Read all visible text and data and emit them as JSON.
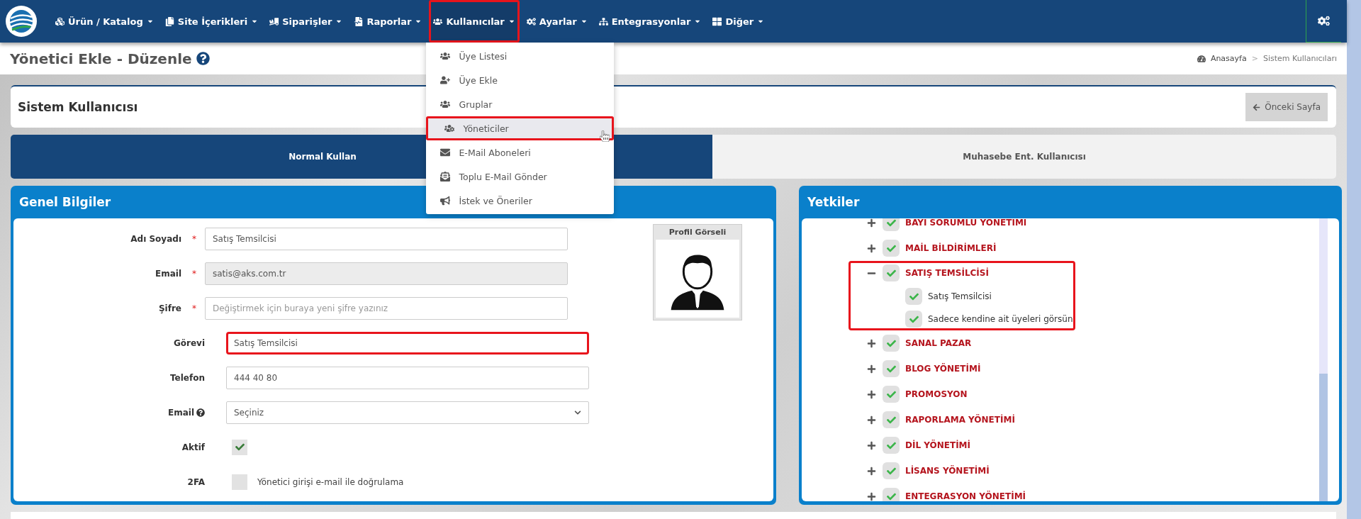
{
  "nav": {
    "items": [
      {
        "label": "Ürün / Katalog",
        "highlighted": false,
        "open": false
      },
      {
        "label": "Site İçerikleri",
        "highlighted": false,
        "open": false
      },
      {
        "label": "Siparişler",
        "highlighted": false,
        "open": false
      },
      {
        "label": "Raporlar",
        "highlighted": false,
        "open": false
      },
      {
        "label": "Kullanıcılar",
        "highlighted": true,
        "open": true
      },
      {
        "label": "Ayarlar",
        "highlighted": false,
        "open": false
      },
      {
        "label": "Entegrasyonlar",
        "highlighted": false,
        "open": false
      },
      {
        "label": "Diğer",
        "highlighted": false,
        "open": false
      }
    ]
  },
  "dropdown": {
    "items": [
      {
        "label": "Üye Listesi",
        "hovered": false,
        "highlighted": false
      },
      {
        "label": "Üye Ekle",
        "hovered": false,
        "highlighted": false
      },
      {
        "label": "Gruplar",
        "hovered": false,
        "highlighted": false
      },
      {
        "label": "Yöneticiler",
        "hovered": true,
        "highlighted": true
      },
      {
        "label": "E-Mail Aboneleri",
        "hovered": false,
        "highlighted": false
      },
      {
        "label": "Toplu E-Mail Gönder",
        "hovered": false,
        "highlighted": false
      },
      {
        "label": "İstek ve Öneriler",
        "hovered": false,
        "highlighted": false
      }
    ]
  },
  "page_title": "Yönetici Ekle - Düzenle",
  "breadcrumb": {
    "separator": ">",
    "items": [
      "Anasayfa",
      "Sistem Kullanıcıları"
    ]
  },
  "card": {
    "title": "Sistem Kullanıcısı",
    "back_button": "Önceki Sayfa"
  },
  "tabs": [
    {
      "label": "Normal Kullan",
      "selected": true
    },
    {
      "label": "Muhasebe Ent. Kullanıcısı",
      "selected": false
    }
  ],
  "general": {
    "title": "Genel Bilgiler",
    "profile_label": "Profil Görseli",
    "fields": [
      {
        "kind": "text",
        "label": "Adı Soyadı",
        "required_mark": "*",
        "help": false,
        "disabled": false,
        "highlighted": false,
        "value": "Satış Temsilcisi"
      },
      {
        "kind": "text",
        "label": "Email",
        "required_mark": "*",
        "help": false,
        "disabled": true,
        "highlighted": false,
        "value": "satis@aks.com.tr"
      },
      {
        "kind": "text",
        "label": "Şifre",
        "required_mark": "*",
        "help": false,
        "disabled": false,
        "highlighted": false,
        "placeholder": "Değiştirmek için buraya yeni şifre yazınız"
      },
      {
        "kind": "text",
        "label": "Görevi",
        "help": false,
        "disabled": false,
        "highlighted": true,
        "value": "Satış Temsilcisi"
      },
      {
        "kind": "text",
        "label": "Telefon",
        "help": false,
        "disabled": false,
        "highlighted": false,
        "value": "444 40 80"
      },
      {
        "kind": "select",
        "label": "Email",
        "help": true,
        "value": "Seçiniz"
      },
      {
        "kind": "checkbox",
        "label": "Aktif",
        "help": false,
        "checked": true
      },
      {
        "kind": "checkbox",
        "label": "2FA",
        "help": false,
        "checked": false,
        "text": "Yönetici girişi e-mail ile doğrulama"
      }
    ]
  },
  "permissions": {
    "title": "Yetkiler",
    "items": [
      {
        "label": "BAYİ SORUMLU YÖNETİMİ",
        "checked": true,
        "expanded": false,
        "highlighted": false
      },
      {
        "label": "MAİL BİLDİRİMLERİ",
        "checked": true,
        "expanded": false,
        "highlighted": false
      },
      {
        "label": "SATIŞ TEMSİLCİSİ",
        "checked": true,
        "expanded": true,
        "highlighted": true,
        "children": [
          {
            "label": "Satış Temsilcisi",
            "checked": true
          },
          {
            "label": "Sadece kendine ait üyeleri görsün",
            "checked": true
          }
        ]
      },
      {
        "label": "SANAL PAZAR",
        "checked": true,
        "expanded": false,
        "highlighted": false
      },
      {
        "label": "BLOG YÖNETİMİ",
        "checked": true,
        "expanded": false,
        "highlighted": false
      },
      {
        "label": "PROMOSYON",
        "checked": true,
        "expanded": false,
        "highlighted": false
      },
      {
        "label": "RAPORLAMA YÖNETİMİ",
        "checked": true,
        "expanded": false,
        "highlighted": false
      },
      {
        "label": "DİL YÖNETİMİ",
        "checked": true,
        "expanded": false,
        "highlighted": false
      },
      {
        "label": "LİSANS YÖNETİMİ",
        "checked": true,
        "expanded": false,
        "highlighted": false
      },
      {
        "label": "ENTEGRASYON YÖNETİMİ",
        "checked": true,
        "expanded": false,
        "highlighted": false
      }
    ]
  }
}
